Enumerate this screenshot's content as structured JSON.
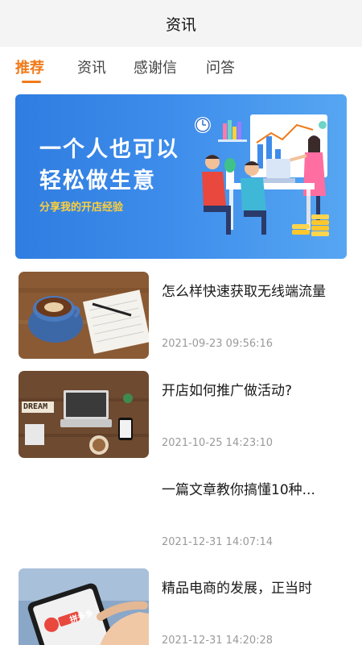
{
  "header": {
    "title": "资讯"
  },
  "tabs": [
    {
      "label": "推荐",
      "active": true
    },
    {
      "label": "资讯",
      "active": false
    },
    {
      "label": "感谢信",
      "active": false
    },
    {
      "label": "问答",
      "active": false
    }
  ],
  "banner": {
    "line1": "一个人也可以",
    "line2": "轻松做生意",
    "subtitle": "分享我的开店经验"
  },
  "articles": [
    {
      "title": "怎么样快速获取无线端流量",
      "time": "2021-09-23 09:56:16",
      "thumb": "coffee-notebook-image"
    },
    {
      "title": "开店如何推广做活动?",
      "time": "2021-10-25 14:23:10",
      "thumb": "laptop-desk-image"
    },
    {
      "title": "一篇文章教你搞懂10种...",
      "time": "2021-12-31 14:07:14",
      "thumb": ""
    },
    {
      "title": "精品电商的发展，正当时",
      "time": "2021-12-31 14:20:28",
      "thumb": "phone-hand-image"
    }
  ],
  "thumb_texts": {
    "dream": "DREAM",
    "app": "拼多多"
  },
  "colors": {
    "accent": "#f07a1a",
    "banner": "#3d8ceb",
    "banner_sub": "#ffd03a"
  }
}
